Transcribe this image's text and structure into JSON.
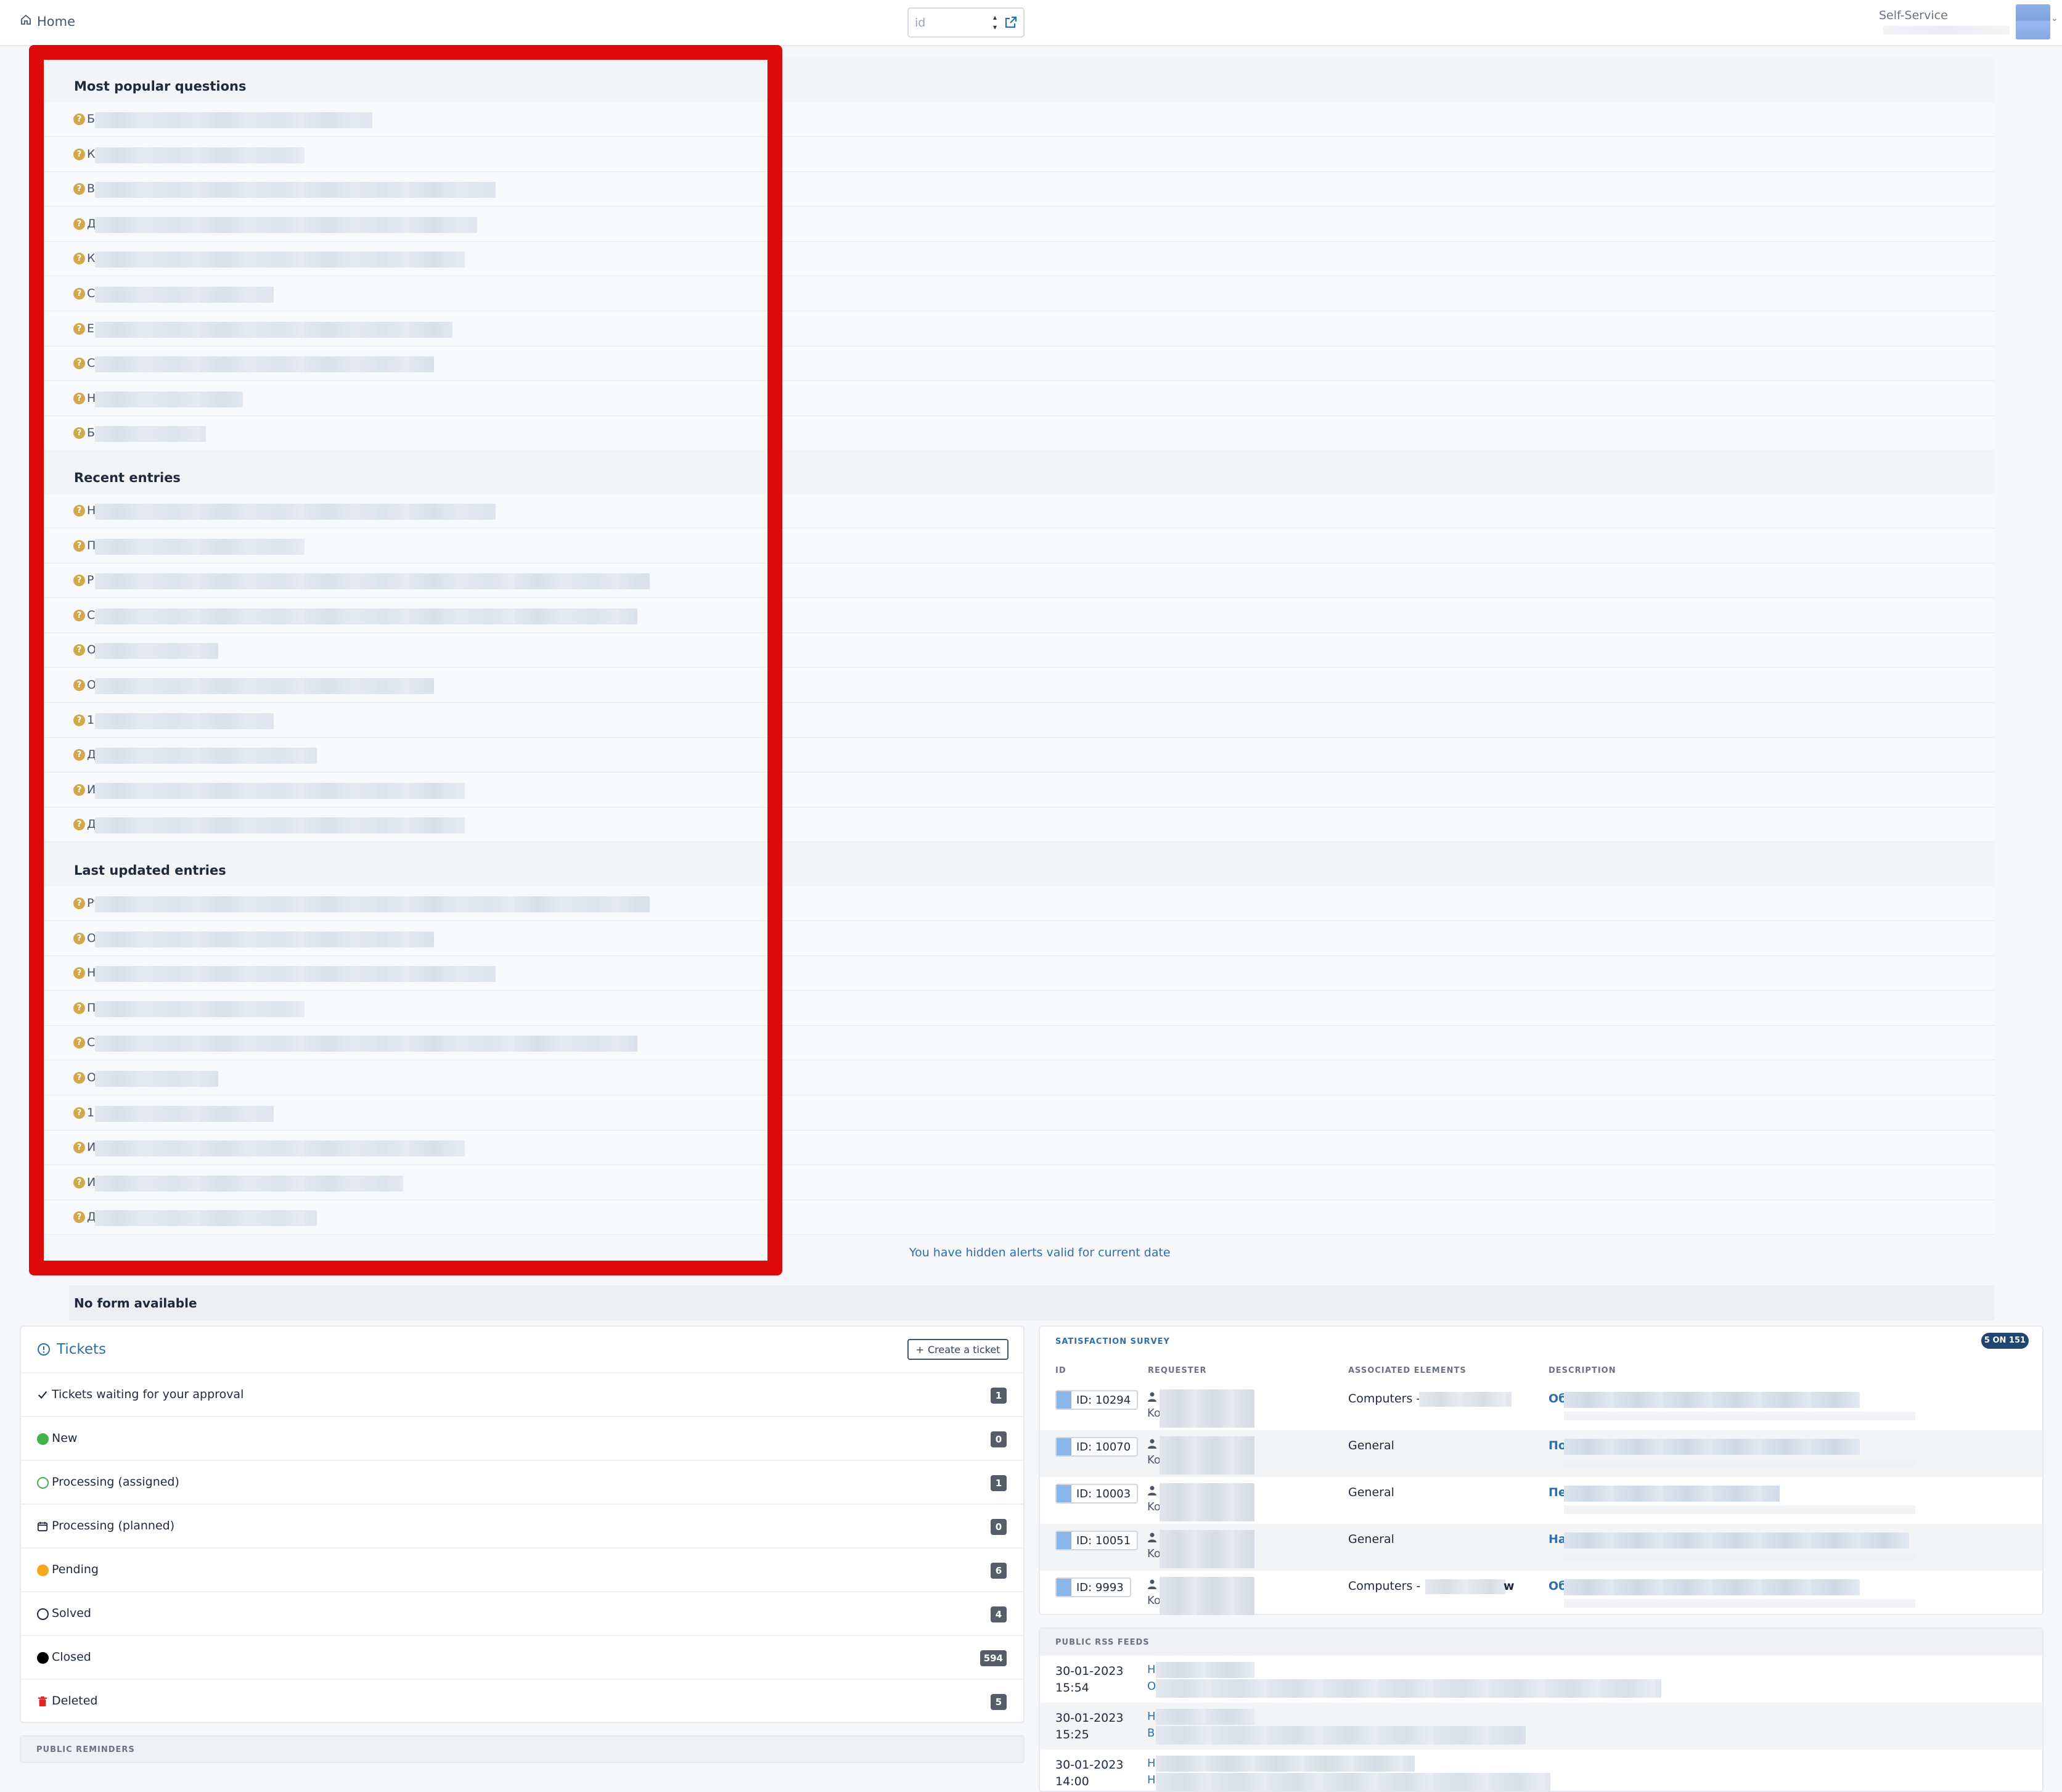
{
  "topbar": {
    "home_label": "Home",
    "id_placeholder": "id",
    "self_service_label": "Self-Service"
  },
  "kb": {
    "sections": [
      {
        "title": "Most popular questions",
        "initials": [
          "Б",
          "К",
          "В",
          "Д",
          "К",
          "С",
          "Е",
          "С",
          "Н",
          "Б"
        ]
      },
      {
        "title": "Recent entries",
        "initials": [
          "Н",
          "П",
          "Р",
          "С",
          "О",
          "О",
          "1С",
          "Д",
          "И",
          "Д"
        ]
      },
      {
        "title": "Last updated entries",
        "initials": [
          "Ру",
          "Об",
          "На",
          "Пе",
          "Ст",
          "Об",
          "1С",
          "Ин",
          "Ин",
          "Д"
        ]
      }
    ],
    "hidden_alerts_text": "You have hidden alerts valid for current date",
    "no_form_text": "No form available"
  },
  "tickets": {
    "title": "Tickets",
    "create_label": "Create a ticket",
    "rows": [
      {
        "label": "Tickets waiting for your approval",
        "count": "1",
        "icon": "check-icon",
        "color": "#1e293b"
      },
      {
        "label": "New",
        "count": "0",
        "icon": "filled-circle-icon",
        "color": "#3fb24a"
      },
      {
        "label": "Processing (assigned)",
        "count": "1",
        "icon": "outline-circle-icon",
        "color": "#3fb24a"
      },
      {
        "label": "Processing (planned)",
        "count": "0",
        "icon": "calendar-icon",
        "color": "#1e293b"
      },
      {
        "label": "Pending",
        "count": "6",
        "icon": "filled-circle-icon",
        "color": "#f5a623"
      },
      {
        "label": "Solved",
        "count": "4",
        "icon": "outline-circle-icon",
        "color": "#1e293b"
      },
      {
        "label": "Closed",
        "count": "594",
        "icon": "filled-circle-icon",
        "color": "#000000"
      },
      {
        "label": "Deleted",
        "count": "5",
        "icon": "trash-icon",
        "color": "#e02424"
      }
    ]
  },
  "reminders": {
    "title": "PUBLIC REMINDERS"
  },
  "survey": {
    "title": "SATISFACTION SURVEY",
    "badge": "5 ON 151",
    "headers": {
      "id": "ID",
      "requester": "REQUESTER",
      "associated": "ASSOCIATED ELEMENTS",
      "description": "DESCRIPTION"
    },
    "rows": [
      {
        "id": "ID: 10294",
        "requester_initial": "Ko",
        "associated": "Computers - s",
        "associated_tail": "",
        "desc_initial": "Об"
      },
      {
        "id": "ID: 10070",
        "requester_initial": "Ko",
        "associated": "General",
        "associated_tail": "",
        "desc_initial": "По"
      },
      {
        "id": "ID: 10003",
        "requester_initial": "Ko",
        "associated": "General",
        "associated_tail": "",
        "desc_initial": "Пе"
      },
      {
        "id": "ID: 10051",
        "requester_initial": "Ko",
        "associated": "General",
        "associated_tail": "",
        "desc_initial": "На"
      },
      {
        "id": "ID: 9993",
        "requester_initial": "Ko",
        "associated": "Computers -",
        "associated_tail": "w",
        "desc_initial": "Об"
      }
    ]
  },
  "rss": {
    "title": "PUBLIC RSS FEEDS",
    "rows": [
      {
        "date": "30-01-2023",
        "time": "15:54",
        "l1": "Н",
        "l2": "О"
      },
      {
        "date": "30-01-2023",
        "time": "15:25",
        "l1": "Н",
        "l2": "В"
      },
      {
        "date": "30-01-2023",
        "time": "14:00",
        "l1": "Н",
        "l2": "Н"
      }
    ]
  },
  "colors": {
    "accent": "#2f6fa8",
    "highlight_frame": "#dd0a0a",
    "badge_dark": "#565d68"
  }
}
